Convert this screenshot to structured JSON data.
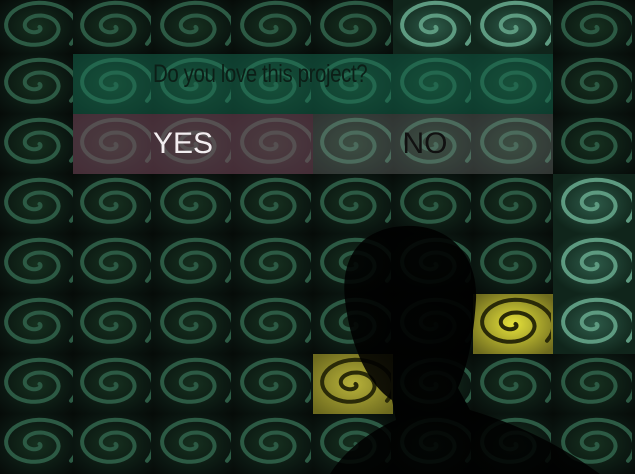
{
  "quiz": {
    "question": "Do you love this project?",
    "answers": {
      "yes_label": "YES",
      "no_label": "NO"
    }
  },
  "background": {
    "tile_icon": "spiral-icon",
    "tile_color": "#1a3a2c",
    "highlight_color": "#e6e23a"
  }
}
